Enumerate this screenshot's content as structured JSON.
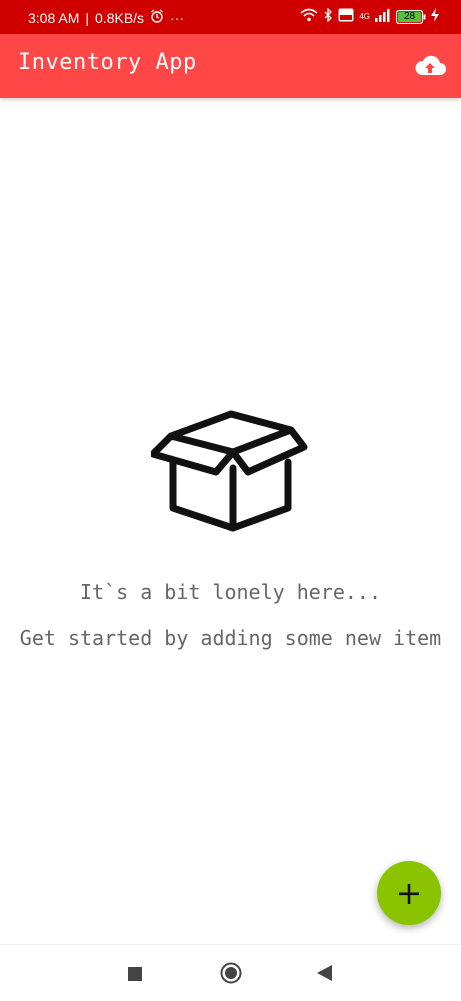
{
  "status_bar": {
    "time": "3:08 AM",
    "speed": "0.8KB/s",
    "more": "···",
    "network": "4G",
    "battery": "28"
  },
  "app_bar": {
    "title": "Inventory App",
    "upload_icon": "cloud-upload-icon"
  },
  "empty_state": {
    "icon": "open-box-icon",
    "title": "It`s a bit lonely here...",
    "subtitle": "Get started by adding some new item"
  },
  "fab": {
    "label": "+",
    "color": "#8ac400"
  },
  "colors": {
    "status_bar": "#d10000",
    "app_bar": "#ff4747",
    "fab": "#8ac400"
  },
  "nav_bar": {
    "icons": [
      "square-recents-icon",
      "circle-home-icon",
      "triangle-back-icon"
    ]
  }
}
